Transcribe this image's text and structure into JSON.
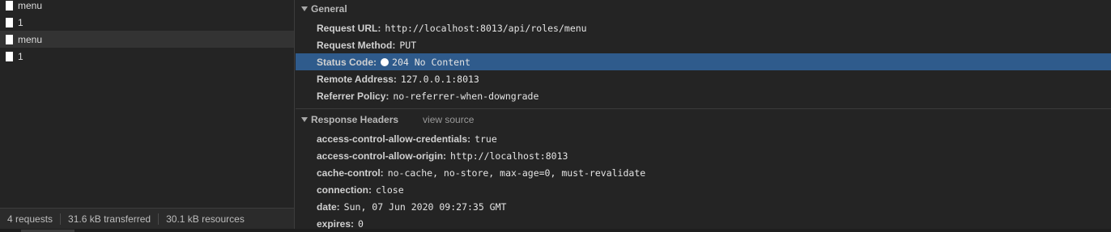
{
  "requests": [
    {
      "name": "menu"
    },
    {
      "name": "1"
    },
    {
      "name": "menu"
    },
    {
      "name": "1"
    }
  ],
  "status_bar": {
    "requests": "4 requests",
    "transferred": "31.6 kB transferred",
    "resources": "30.1 kB resources"
  },
  "general": {
    "title": "General",
    "rows": [
      {
        "key": "Request URL:",
        "value": "http://localhost:8013/api/roles/menu"
      },
      {
        "key": "Request Method:",
        "value": "PUT"
      },
      {
        "key": "Status Code:",
        "value": "204 No Content"
      },
      {
        "key": "Remote Address:",
        "value": "127.0.0.1:8013"
      },
      {
        "key": "Referrer Policy:",
        "value": "no-referrer-when-downgrade"
      }
    ]
  },
  "response_headers": {
    "title": "Response Headers",
    "view_source": "view source",
    "rows": [
      {
        "key": "access-control-allow-credentials:",
        "value": "true"
      },
      {
        "key": "access-control-allow-origin:",
        "value": "http://localhost:8013"
      },
      {
        "key": "cache-control:",
        "value": "no-cache, no-store, max-age=0, must-revalidate"
      },
      {
        "key": "connection:",
        "value": "close"
      },
      {
        "key": "date:",
        "value": "Sun, 07 Jun 2020 09:27:35 GMT"
      },
      {
        "key": "expires:",
        "value": "0"
      }
    ]
  },
  "colors": {
    "background": "#242424",
    "selected_row": "#2f5b8c",
    "status_dot": "#ffffff"
  }
}
